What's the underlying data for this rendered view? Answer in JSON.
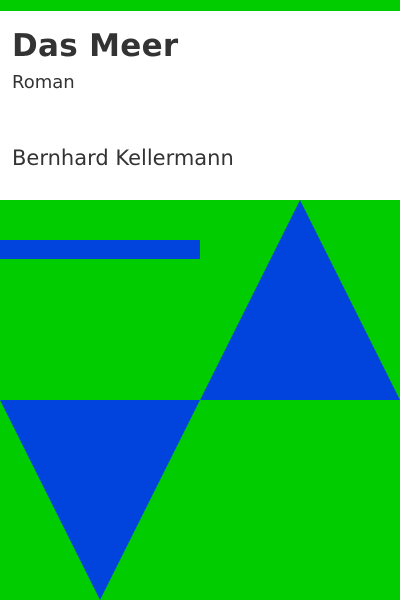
{
  "book": {
    "title": "Das Meer",
    "subtitle": "Roman",
    "author": "Bernhard Kellermann"
  },
  "colors": {
    "background": "#ffffff",
    "text": "#333333",
    "green": "#00cc00",
    "blue": "#0044dd"
  }
}
